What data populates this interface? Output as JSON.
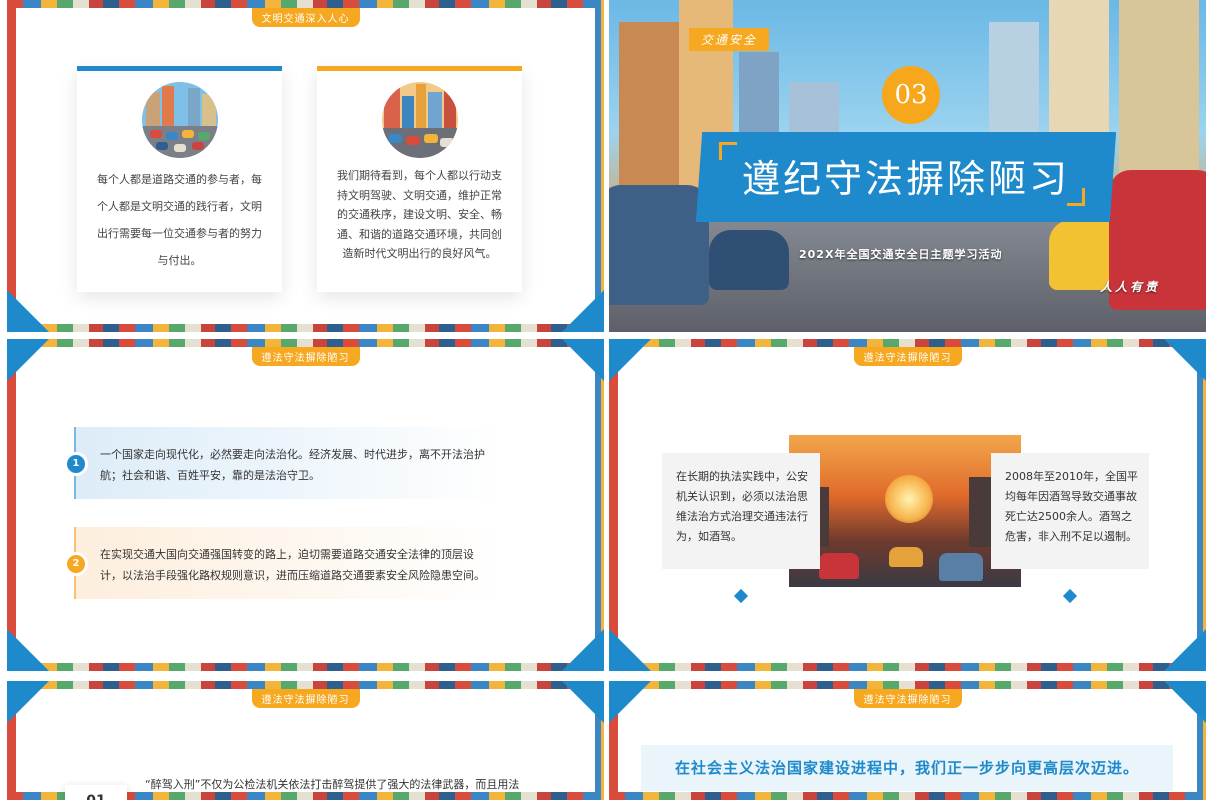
{
  "slides": {
    "s1": {
      "tag": "文明交通深入人心",
      "card1_text": "每个人都是道路交通的参与者，每个人都是文明交通的践行者，文明出行需要每一位交通参与者的努力与付出。",
      "card2_text": "我们期待看到，每个人都以行动支持文明驾驶、文明交通，维护正常的交通秩序，建设文明、安全、畅通、和谐的道路交通环境，共同创造新时代文明出行的良好风气。"
    },
    "s2": {
      "tag": "交通安全",
      "number": "03",
      "title": "遵纪守法摒除陋习",
      "subtitle": "202X年全国交通安全日主题学习活动",
      "slogan": "人人有责"
    },
    "s3": {
      "tag": "遵法守法摒除陋习",
      "item1_num": "1",
      "item1_text": "一个国家走向现代化，必然要走向法治化。经济发展、时代进步，离不开法治护航；社会和谐、百姓平安，靠的是法治守卫。",
      "item2_num": "2",
      "item2_text": "在实现交通大国向交通强国转变的路上，迫切需要道路交通安全法律的顶层设计，以法治手段强化路权规则意识，进而压缩道路交通要素安全风险隐患空间。"
    },
    "s4": {
      "tag": "遵法守法摒除陋习",
      "left_text": "在长期的执法实践中，公安机关认识到，必须以法治思维法治方式治理交通违法行为，如酒驾。",
      "right_text": "2008年至2010年，全国平均每年因酒驾导致交通事故死亡达2500余人。酒驾之危害，非入刑不足以遏制。"
    },
    "s5": {
      "tag": "遵法守法摒除陋习",
      "number": "01",
      "quote": "“醉驾入刑”不仅为公检法机关依法打击醉驾提供了强大的法律武器，而且用法"
    },
    "s6": {
      "tag": "遵法守法摒除陋习",
      "banner": "在社会主义法治国家建设进程中，我们正一步步向更高层次迈进。"
    }
  },
  "colors": {
    "accent_blue": "#1f8acb",
    "accent_orange": "#f6a821"
  }
}
